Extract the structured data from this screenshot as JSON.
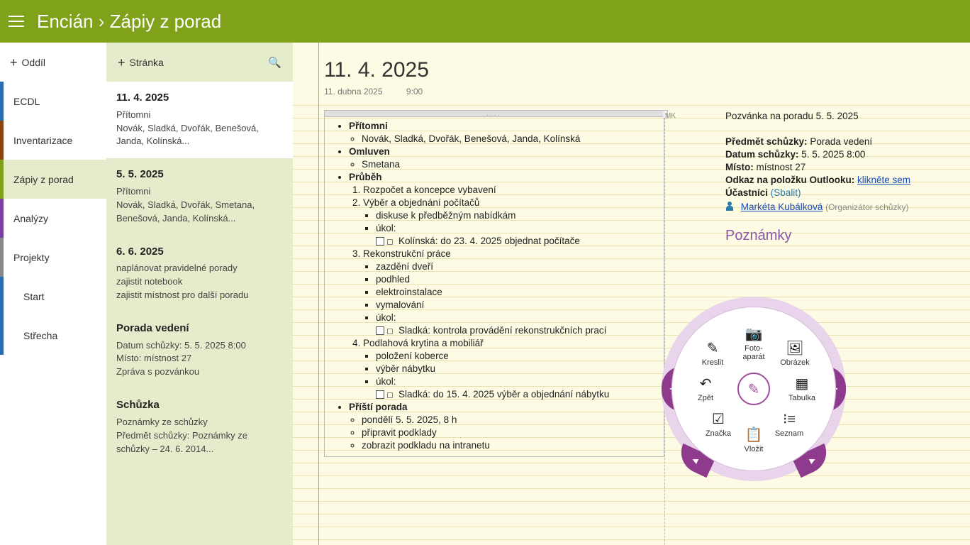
{
  "title": {
    "notebook": "Encián",
    "section": "Zápiy z porad",
    "arrow": "›"
  },
  "sections": {
    "add_label": "Oddíl",
    "items": [
      {
        "label": "ECDL"
      },
      {
        "label": "Inventarizace"
      },
      {
        "label": "Zápiy z porad"
      },
      {
        "label": "Analýzy"
      },
      {
        "label": "Projekty"
      }
    ],
    "sub": [
      {
        "label": "Start"
      },
      {
        "label": "Střecha"
      }
    ]
  },
  "pages": {
    "add_label": "Stránka",
    "items": [
      {
        "title": "11. 4. 2025",
        "line1": "Přítomni",
        "line2": "Novák, Sladká, Dvořák, Benešová, Janda, Kolínská..."
      },
      {
        "title": "5. 5. 2025",
        "line1": "Přítomni",
        "line2": "Novák, Sladká, Dvořák, Smetana, Benešová, Janda, Kolínská..."
      },
      {
        "title": "6. 6. 2025",
        "line1": "naplánovat pravidelné porady",
        "line2": "zajistit notebook",
        "line3": "zajistit místnost pro další poradu"
      },
      {
        "title": "Porada vedení",
        "line1": "Datum schůzky: 5. 5. 2025 8:00",
        "line2": "Místo: místnost 27",
        "line3": "Zpráva s pozvánkou"
      },
      {
        "title": "Schůzka",
        "line1": "Poznámky ze schůzky",
        "line2": "Předmět schůzky: Poznámky ze schůzky – 24. 6. 2014..."
      }
    ]
  },
  "note": {
    "title": "11. 4. 2025",
    "date": "11. dubna 2025",
    "time": "9:00",
    "bullets": {
      "pritomni_label": "Přítomni",
      "pritomni_value": "Novák, Sladká, Dvořák, Benešová, Janda, Kolínská",
      "omluven_label": "Omluven",
      "omluven_value": "Smetana",
      "prubeh_label": "Průběh",
      "p1": "Rozpočet a koncepce vybavení",
      "p2": "Výběr a objednání počítačů",
      "p2a": "diskuse k předběžným nabídkám",
      "p2b": "úkol:",
      "p2b_task": "Kolínská: do 23. 4. 2025 objednat počítače",
      "p3": "Rekonstrukční práce",
      "p3a": "zazdění dveří",
      "p3b": "podhled",
      "p3c": "elektroinstalace",
      "p3d": "vymalování",
      "p3e": "úkol:",
      "p3e_task": "Sladká: kontrola provádění rekonstrukčních prací",
      "p4": "Podlahová krytina a mobiliář",
      "p4a": "položení koberce",
      "p4b": "výběr nábytku",
      "p4c": "úkol:",
      "p4c_task": "Sladká: do 15. 4. 2025 výběr a objednání nábytku",
      "pristi_label": "Příští porada",
      "pristi_a": "pondělí 5. 5. 2025, 8 h",
      "pristi_b": "připravit podklady",
      "pristi_c": "zobrazit podkladu na intranetu"
    }
  },
  "invite": {
    "mk": "MK",
    "header": "Pozvánka na poradu 5. 5. 2025",
    "predmet_l": "Předmět schůzky:",
    "predmet_v": "Porada vedení",
    "datum_l": "Datum schůzky:",
    "datum_v": "5. 5. 2025 8:00",
    "misto_l": "Místo:",
    "misto_v": "místnost 27",
    "odkaz_l": "Odkaz na položku Outlooku:",
    "odkaz_v": "klikněte sem",
    "ucastnici_l": "Účastníci",
    "sbalit": "(Sbalit)",
    "organizer": "Markéta Kubálková",
    "organizer_role": "(Organizátor schůzky)",
    "poznamky": "Poznámky"
  },
  "radial": {
    "kreslit": "Kreslit",
    "foto": "Foto-\naparát",
    "obrazek": "Obrázek",
    "zpet": "Zpět",
    "tabulka": "Tabulka",
    "znacka": "Značka",
    "vlozit": "Vložit",
    "seznam": "Seznam"
  }
}
